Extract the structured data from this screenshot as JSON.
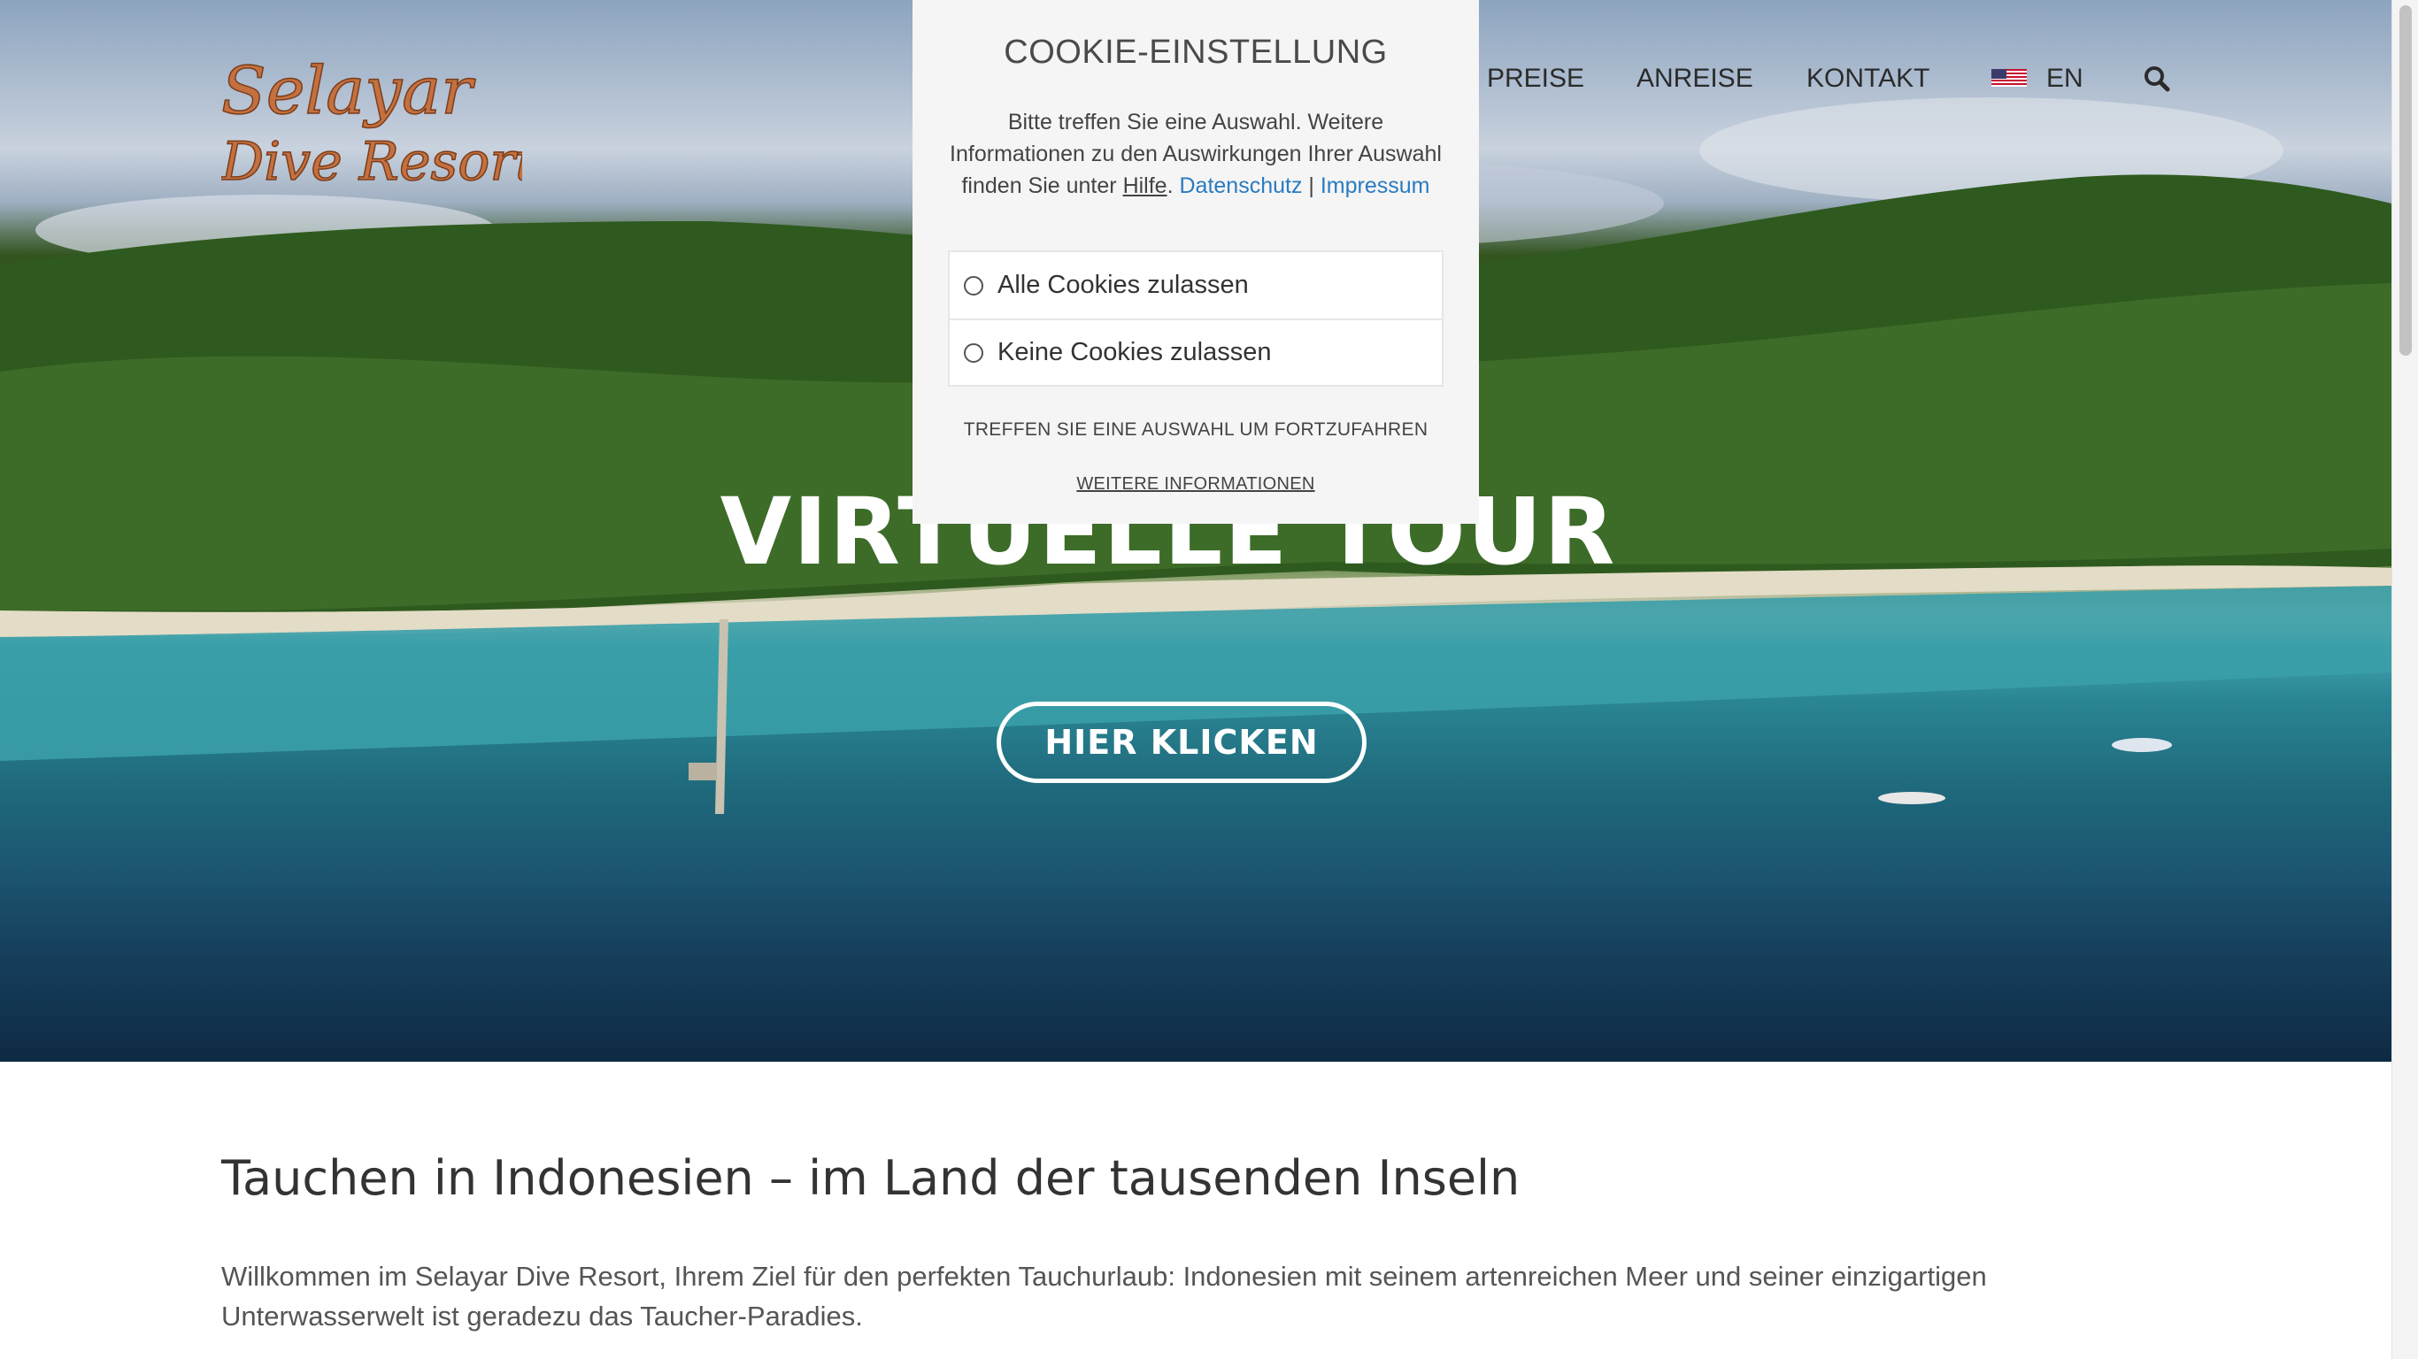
{
  "header": {
    "logo_line1": "Selayar",
    "logo_line2": "Dive Resort",
    "nav": [
      "PREISE",
      "ANREISE",
      "KONTAKT"
    ],
    "language": "EN"
  },
  "hero": {
    "title": "VIRTUELLE TOUR",
    "button": "HIER KLICKEN"
  },
  "cookie": {
    "title": "COOKIE-EINSTELLUNG",
    "text_prefix": "Bitte treffen Sie eine Auswahl. Weitere Informationen zu den Auswirkungen Ihrer Auswahl finden Sie unter ",
    "help_link": "Hilfe",
    "dot": ".",
    "privacy_link": "Datenschutz",
    "separator": "|",
    "imprint_link": "Impressum",
    "options": [
      "Alle Cookies zulassen",
      "Keine Cookies zulassen"
    ],
    "hint": "TREFFEN SIE EINE AUSWAHL UM FORTZUFAHREN",
    "more_link": "WEITERE INFORMATIONEN"
  },
  "main": {
    "heading": "Tauchen in Indonesien – im Land der tausenden Inseln",
    "intro": "Willkommen im Selayar Dive Resort, Ihrem Ziel für den perfekten Tauchurlaub: Indonesien mit seinem artenreichen Meer und seiner einzigartigen Unterwasserwelt ist geradezu das Taucher-Paradies."
  },
  "colors": {
    "link": "#2a7bc0",
    "logo": "#c4703f"
  },
  "icons": [
    "search-icon",
    "us-flag-icon",
    "radio-icon"
  ]
}
